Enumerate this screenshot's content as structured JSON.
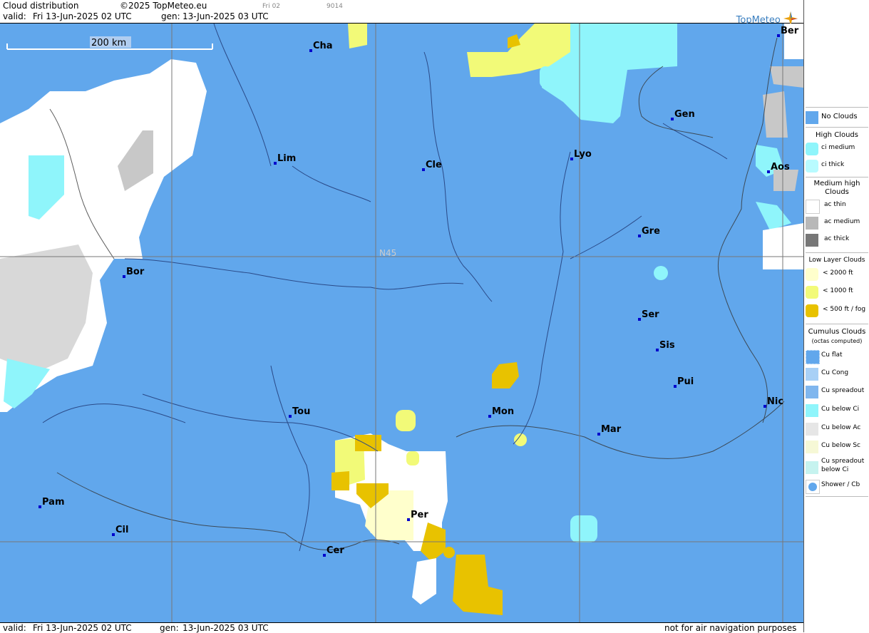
{
  "header": {
    "title": "Cloud distribution",
    "copyright": "©2025 TopMeteo.eu",
    "valid_label": "valid:",
    "valid_value": "Fri  13-Jun-2025  02 UTC",
    "gen_label": "gen:",
    "gen_value": "13-Jun-2025 03 UTC",
    "run_small": "Fri 02",
    "code_small": "9014",
    "logo_text": "TopMeteo"
  },
  "footer": {
    "valid_label": "valid:",
    "valid_value": "Fri  13-Jun-2025  02 UTC",
    "gen_label": "gen:",
    "gen_value": "13-Jun-2025 03 UTC",
    "disclaimer": "not for air navigation purposes"
  },
  "map": {
    "scale_label": "200 km",
    "latitude_label": "N45",
    "colors": {
      "sea_land": "#61a7ec",
      "ci": "#8ff5fb",
      "ac_thin": "#ffffff",
      "ac_medium": "#c8c8c8",
      "low_2000": "#ffffcc",
      "low_1000": "#f2fa78",
      "low_500": "#e8c200"
    },
    "cities": [
      {
        "name": "Cha"
      },
      {
        "name": "Ber"
      },
      {
        "name": "Gen"
      },
      {
        "name": "Lim"
      },
      {
        "name": "Cle"
      },
      {
        "name": "Lyo"
      },
      {
        "name": "Aos"
      },
      {
        "name": "Gre"
      },
      {
        "name": "Bor"
      },
      {
        "name": "Ser"
      },
      {
        "name": "Sis"
      },
      {
        "name": "Pui"
      },
      {
        "name": "Tou"
      },
      {
        "name": "Mon"
      },
      {
        "name": "Mar"
      },
      {
        "name": "Nic"
      },
      {
        "name": "Pam"
      },
      {
        "name": "Cil"
      },
      {
        "name": "Per"
      },
      {
        "name": "Cer"
      }
    ]
  },
  "legend": {
    "no_clouds": "No Clouds",
    "high_title": "High Clouds",
    "ci_medium": "ci medium",
    "ci_thick": "ci thick",
    "medium_title_1": "Medium high",
    "medium_title_2": "Clouds",
    "ac_thin": "ac thin",
    "ac_medium": "ac medium",
    "ac_thick": "ac thick",
    "low_title": "Low Layer Clouds",
    "low_2000": "< 2000 ft",
    "low_1000": "< 1000 ft",
    "low_500": "< 500 ft / fog",
    "cu_title": "Cumulus Clouds",
    "cu_sub": "(octas computed)",
    "cu_flat": "Cu flat",
    "cu_cong": "Cu Cong",
    "cu_spreadout": "Cu spreadout",
    "cu_below_ci": "Cu below Ci",
    "cu_below_ac": "Cu below Ac",
    "cu_below_sc": "Cu below Sc",
    "cu_spread_ci_1": "Cu spreadout",
    "cu_spread_ci_2": "below Ci",
    "shower": "Shower / Cb"
  }
}
